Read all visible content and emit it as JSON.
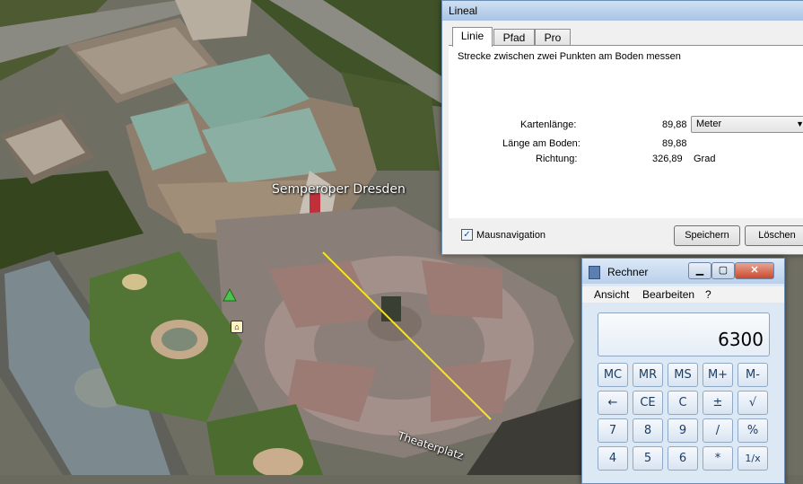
{
  "map": {
    "labels": {
      "building": "Semperoper Dresden",
      "square": "Theaterplatz"
    }
  },
  "ruler_window": {
    "title": "Lineal",
    "tabs": [
      "Linie",
      "Pfad",
      "Pro"
    ],
    "description": "Strecke zwischen zwei Punkten am Boden messen",
    "map_length_label": "Kartenlänge:",
    "map_length_value": "89,88",
    "unit_selected": "Meter",
    "ground_length_label": "Länge am Boden:",
    "ground_length_value": "89,88",
    "heading_label": "Richtung:",
    "heading_value": "326,89",
    "heading_unit": "Grad",
    "mouse_nav_label": "Mausnavigation",
    "mouse_nav_checked": true,
    "save_label": "Speichern",
    "clear_label": "Löschen"
  },
  "calculator": {
    "title": "Rechner",
    "menu": [
      "Ansicht",
      "Bearbeiten",
      "?"
    ],
    "display": "6300",
    "rows": [
      [
        "MC",
        "MR",
        "MS",
        "M+",
        "M-"
      ],
      [
        "←",
        "CE",
        "C",
        "±",
        "√"
      ],
      [
        "7",
        "8",
        "9",
        "/",
        "%"
      ],
      [
        "4",
        "5",
        "6",
        "*",
        "1/x"
      ]
    ]
  },
  "colors": {
    "measure_line": "#f5e61f",
    "window_frame": "#6d8fb3",
    "calc_button_text": "#1e3c62"
  }
}
